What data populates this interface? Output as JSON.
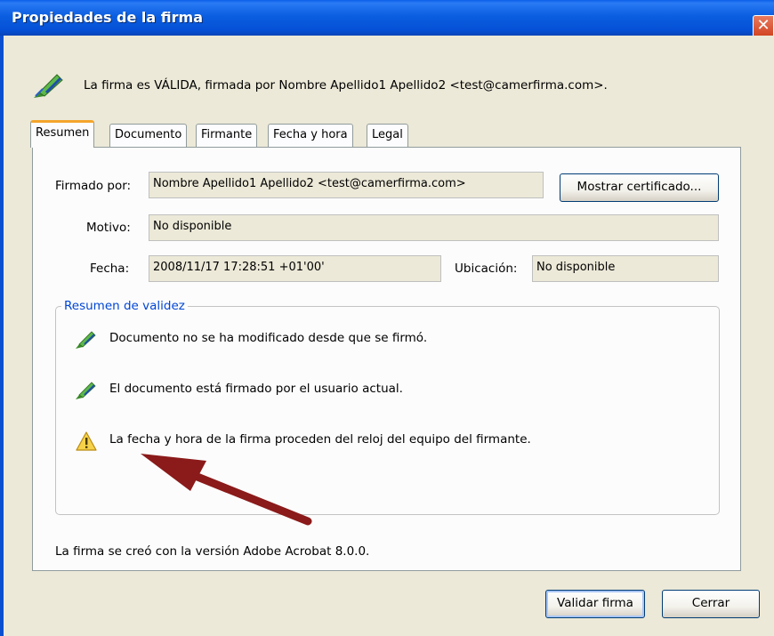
{
  "window": {
    "title": "Propiedades de la firma",
    "close_glyph": "✕"
  },
  "header": {
    "icon": "signature-valid-pen-icon",
    "text": "La firma es VÁLIDA, firmada por Nombre Apellido1 Apellido2 <test@camerfirma.com>."
  },
  "tabs": [
    {
      "label": "Resumen",
      "active": true
    },
    {
      "label": "Documento",
      "active": false
    },
    {
      "label": "Firmante",
      "active": false
    },
    {
      "label": "Fecha y hora",
      "active": false
    },
    {
      "label": "Legal",
      "active": false
    }
  ],
  "summary": {
    "signed_by_label": "Firmado por:",
    "signed_by_value": "Nombre Apellido1 Apellido2 <test@camerfirma.com>",
    "show_certificate_button": "Mostrar certificado...",
    "reason_label": "Motivo:",
    "reason_value": "No disponible",
    "date_label": "Fecha:",
    "date_value": "2008/11/17 17:28:51 +01'00'",
    "location_label": "Ubicación:",
    "location_value": "No disponible"
  },
  "validity": {
    "legend": "Resumen de validez",
    "items": [
      {
        "icon": "valid-pen-icon",
        "text": "Documento no se ha modificado desde que se firmó."
      },
      {
        "icon": "valid-pen-icon",
        "text": "El documento está firmado por el usuario actual."
      },
      {
        "icon": "warning-icon",
        "text": "La fecha y hora de la firma proceden del reloj del equipo del firmante."
      }
    ]
  },
  "footer": {
    "version_text": "La firma se creó con la versión Adobe Acrobat 8.0.0."
  },
  "buttons": {
    "validate": "Validar firma",
    "close": "Cerrar"
  },
  "colors": {
    "title_bar": "#0550d6",
    "dialog_bg": "#ece9d8",
    "legend_text": "#0046d5",
    "annotation_arrow": "#8b1a1a",
    "active_tab_accent": "#f4a52b"
  }
}
